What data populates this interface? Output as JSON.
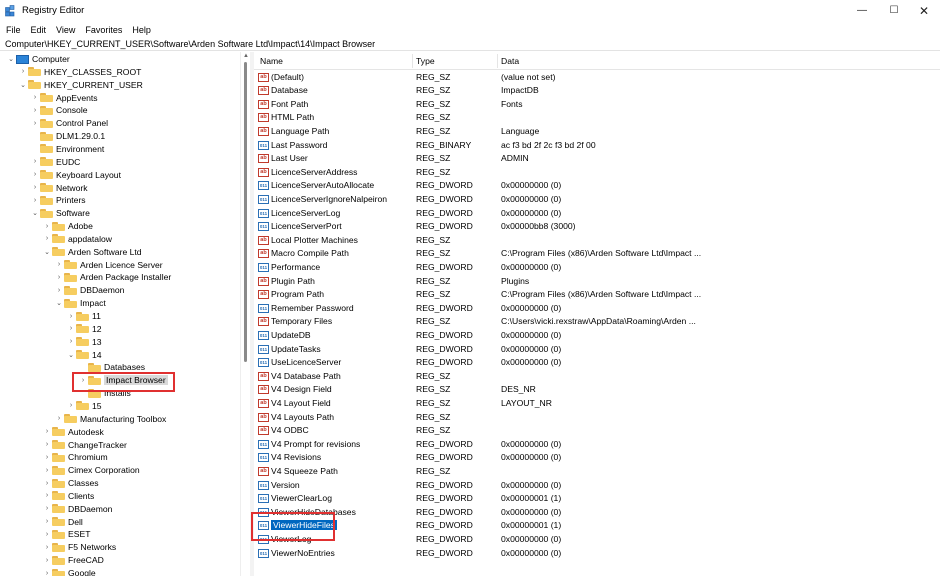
{
  "window": {
    "title": "Registry Editor",
    "min": "—",
    "max": "☐",
    "close": "✕"
  },
  "menu": [
    "File",
    "Edit",
    "View",
    "Favorites",
    "Help"
  ],
  "address": "Computer\\HKEY_CURRENT_USER\\Software\\Arden Software Ltd\\Impact\\14\\Impact Browser",
  "tree": [
    {
      "label": "Computer",
      "level": 0,
      "chev": "open",
      "icon": "computer"
    },
    {
      "label": "HKEY_CLASSES_ROOT",
      "level": 1,
      "chev": "closed"
    },
    {
      "label": "HKEY_CURRENT_USER",
      "level": 1,
      "chev": "open"
    },
    {
      "label": "AppEvents",
      "level": 2,
      "chev": "closed"
    },
    {
      "label": "Console",
      "level": 2,
      "chev": "closed"
    },
    {
      "label": "Control Panel",
      "level": 2,
      "chev": "closed"
    },
    {
      "label": "DLM1.29.0.1",
      "level": 2,
      "chev": "none"
    },
    {
      "label": "Environment",
      "level": 2,
      "chev": "none"
    },
    {
      "label": "EUDC",
      "level": 2,
      "chev": "closed"
    },
    {
      "label": "Keyboard Layout",
      "level": 2,
      "chev": "closed"
    },
    {
      "label": "Network",
      "level": 2,
      "chev": "closed"
    },
    {
      "label": "Printers",
      "level": 2,
      "chev": "closed"
    },
    {
      "label": "Software",
      "level": 2,
      "chev": "open"
    },
    {
      "label": "Adobe",
      "level": 3,
      "chev": "closed"
    },
    {
      "label": "appdatalow",
      "level": 3,
      "chev": "closed"
    },
    {
      "label": "Arden Software Ltd",
      "level": 3,
      "chev": "open"
    },
    {
      "label": "Arden Licence Server",
      "level": 4,
      "chev": "closed"
    },
    {
      "label": "Arden Package Installer",
      "level": 4,
      "chev": "closed"
    },
    {
      "label": "DBDaemon",
      "level": 4,
      "chev": "closed"
    },
    {
      "label": "Impact",
      "level": 4,
      "chev": "open"
    },
    {
      "label": "11",
      "level": 5,
      "chev": "closed"
    },
    {
      "label": "12",
      "level": 5,
      "chev": "closed"
    },
    {
      "label": "13",
      "level": 5,
      "chev": "closed"
    },
    {
      "label": "14",
      "level": 5,
      "chev": "open"
    },
    {
      "label": "Databases",
      "level": 6,
      "chev": "none"
    },
    {
      "label": "Impact Browser",
      "level": 6,
      "chev": "closed",
      "selected": true
    },
    {
      "label": "Installs",
      "level": 6,
      "chev": "none"
    },
    {
      "label": "15",
      "level": 5,
      "chev": "closed"
    },
    {
      "label": "Manufacturing Toolbox",
      "level": 4,
      "chev": "closed"
    },
    {
      "label": "Autodesk",
      "level": 3,
      "chev": "closed"
    },
    {
      "label": "ChangeTracker",
      "level": 3,
      "chev": "closed"
    },
    {
      "label": "Chromium",
      "level": 3,
      "chev": "closed"
    },
    {
      "label": "Cimex Corporation",
      "level": 3,
      "chev": "closed"
    },
    {
      "label": "Classes",
      "level": 3,
      "chev": "closed"
    },
    {
      "label": "Clients",
      "level": 3,
      "chev": "closed"
    },
    {
      "label": "DBDaemon",
      "level": 3,
      "chev": "closed"
    },
    {
      "label": "Dell",
      "level": 3,
      "chev": "closed"
    },
    {
      "label": "ESET",
      "level": 3,
      "chev": "closed"
    },
    {
      "label": "F5 Networks",
      "level": 3,
      "chev": "closed"
    },
    {
      "label": "FreeCAD",
      "level": 3,
      "chev": "closed"
    },
    {
      "label": "Google",
      "level": 3,
      "chev": "closed"
    }
  ],
  "columns": {
    "name": "Name",
    "type": "Type",
    "data": "Data"
  },
  "values": [
    {
      "name": "(Default)",
      "type": "REG_SZ",
      "data": "(value not set)",
      "icon": "ab"
    },
    {
      "name": "Database",
      "type": "REG_SZ",
      "data": "ImpactDB",
      "icon": "ab"
    },
    {
      "name": "Font Path",
      "type": "REG_SZ",
      "data": "Fonts",
      "icon": "ab"
    },
    {
      "name": "HTML Path",
      "type": "REG_SZ",
      "data": "",
      "icon": "ab"
    },
    {
      "name": "Language Path",
      "type": "REG_SZ",
      "data": "Language",
      "icon": "ab"
    },
    {
      "name": "Last Password",
      "type": "REG_BINARY",
      "data": "ac f3 bd 2f 2c f3 bd 2f 00",
      "icon": "bin"
    },
    {
      "name": "Last User",
      "type": "REG_SZ",
      "data": "ADMIN",
      "icon": "ab"
    },
    {
      "name": "LicenceServerAddress",
      "type": "REG_SZ",
      "data": "",
      "icon": "ab"
    },
    {
      "name": "LicenceServerAutoAllocate",
      "type": "REG_DWORD",
      "data": "0x00000000 (0)",
      "icon": "bin"
    },
    {
      "name": "LicenceServerIgnoreNalpeiron",
      "type": "REG_DWORD",
      "data": "0x00000000 (0)",
      "icon": "bin"
    },
    {
      "name": "LicenceServerLog",
      "type": "REG_DWORD",
      "data": "0x00000000 (0)",
      "icon": "bin"
    },
    {
      "name": "LicenceServerPort",
      "type": "REG_DWORD",
      "data": "0x00000bb8 (3000)",
      "icon": "bin"
    },
    {
      "name": "Local Plotter Machines",
      "type": "REG_SZ",
      "data": "",
      "icon": "ab"
    },
    {
      "name": "Macro Compile Path",
      "type": "REG_SZ",
      "data": "C:\\Program Files (x86)\\Arden Software Ltd\\Impact ...",
      "icon": "ab"
    },
    {
      "name": "Performance",
      "type": "REG_DWORD",
      "data": "0x00000000 (0)",
      "icon": "bin"
    },
    {
      "name": "Plugin Path",
      "type": "REG_SZ",
      "data": "Plugins",
      "icon": "ab"
    },
    {
      "name": "Program Path",
      "type": "REG_SZ",
      "data": "C:\\Program Files (x86)\\Arden Software Ltd\\Impact ...",
      "icon": "ab"
    },
    {
      "name": "Remember Password",
      "type": "REG_DWORD",
      "data": "0x00000000 (0)",
      "icon": "bin"
    },
    {
      "name": "Temporary Files",
      "type": "REG_SZ",
      "data": "C:\\Users\\vicki.rexstraw\\AppData\\Roaming\\Arden ...",
      "icon": "ab"
    },
    {
      "name": "UpdateDB",
      "type": "REG_DWORD",
      "data": "0x00000000 (0)",
      "icon": "bin"
    },
    {
      "name": "UpdateTasks",
      "type": "REG_DWORD",
      "data": "0x00000000 (0)",
      "icon": "bin"
    },
    {
      "name": "UseLicenceServer",
      "type": "REG_DWORD",
      "data": "0x00000000 (0)",
      "icon": "bin"
    },
    {
      "name": "V4 Database Path",
      "type": "REG_SZ",
      "data": "",
      "icon": "ab"
    },
    {
      "name": "V4 Design Field",
      "type": "REG_SZ",
      "data": "DES_NR",
      "icon": "ab"
    },
    {
      "name": "V4 Layout Field",
      "type": "REG_SZ",
      "data": "LAYOUT_NR",
      "icon": "ab"
    },
    {
      "name": "V4 Layouts Path",
      "type": "REG_SZ",
      "data": "",
      "icon": "ab"
    },
    {
      "name": "V4 ODBC",
      "type": "REG_SZ",
      "data": "",
      "icon": "ab"
    },
    {
      "name": "V4 Prompt for revisions",
      "type": "REG_DWORD",
      "data": "0x00000000 (0)",
      "icon": "bin"
    },
    {
      "name": "V4 Revisions",
      "type": "REG_DWORD",
      "data": "0x00000000 (0)",
      "icon": "bin"
    },
    {
      "name": "V4 Squeeze Path",
      "type": "REG_SZ",
      "data": "",
      "icon": "ab"
    },
    {
      "name": "Version",
      "type": "REG_DWORD",
      "data": "0x00000000 (0)",
      "icon": "bin"
    },
    {
      "name": "ViewerClearLog",
      "type": "REG_DWORD",
      "data": "0x00000001 (1)",
      "icon": "bin"
    },
    {
      "name": "ViewerHideDatabases",
      "type": "REG_DWORD",
      "data": "0x00000000 (0)",
      "icon": "bin"
    },
    {
      "name": "ViewerHideFiles",
      "type": "REG_DWORD",
      "data": "0x00000001 (1)",
      "icon": "bin",
      "selected": true
    },
    {
      "name": "ViewerLog",
      "type": "REG_DWORD",
      "data": "0x00000000 (0)",
      "icon": "bin"
    },
    {
      "name": "ViewerNoEntries",
      "type": "REG_DWORD",
      "data": "0x00000000 (0)",
      "icon": "bin"
    }
  ],
  "colors": {
    "selection": "#0067c0",
    "highlight_box": "#e03030",
    "folder": "#f6cd60"
  }
}
